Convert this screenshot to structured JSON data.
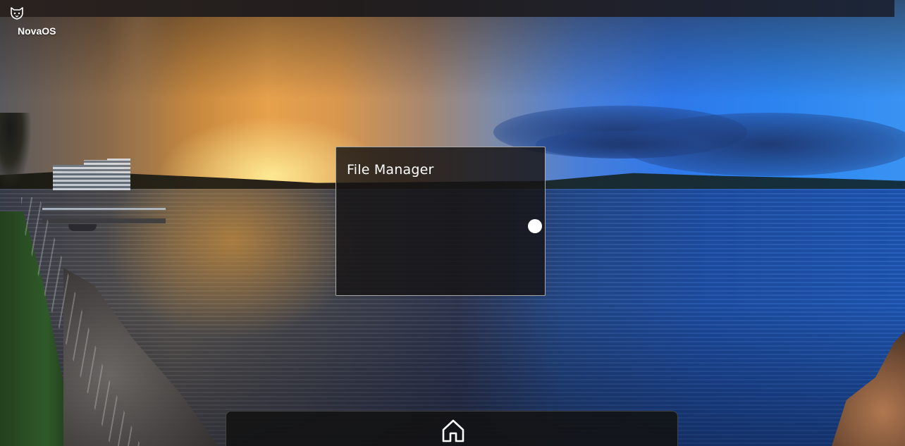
{
  "os": {
    "name": "NovaOS",
    "logo_icon": "fox-icon"
  },
  "window": {
    "title": "File Manager",
    "resize_handle_icon": "circle-handle-icon"
  },
  "dock": {
    "home_icon": "home-icon"
  },
  "wallpaper": {
    "scene": "sunset-lake-panorama"
  },
  "colors": {
    "window_background": "#161414",
    "window_border": "#a8a8a8",
    "dock_background": "#121212",
    "text": "#ffffff"
  }
}
